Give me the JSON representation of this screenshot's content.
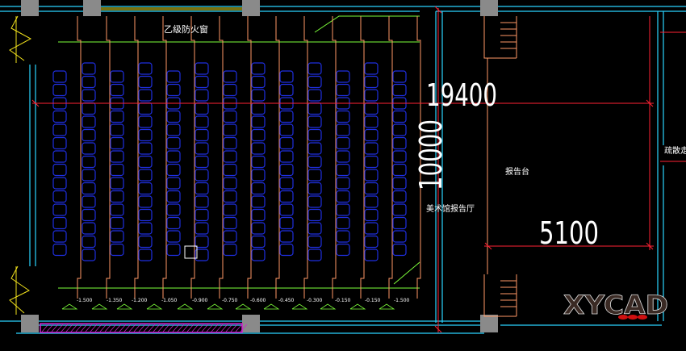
{
  "labels": {
    "window_type": "乙级防火窗",
    "stage": "报告台",
    "hall": "美术馆报告厅",
    "evac": "疏散走",
    "logo": "XYCAD"
  },
  "dimensions": {
    "total_width": "19400",
    "depth": "10000",
    "stage_width": "5100"
  },
  "elevations": [
    "-1.500",
    "-1.350",
    "-1.200",
    "-1.050",
    "-0.900",
    "-0.750",
    "-0.600",
    "-0.450",
    "-0.300",
    "-0.150",
    "-0.150"
  ],
  "colors": {
    "seat": "#1f2fe0",
    "row_line": "#ff9966",
    "dim_line": "#ff2233",
    "wall_gray": "#8a8a8a",
    "green": "#7dff3a",
    "cyan": "#2ad4ff",
    "hatch": "#d020d0",
    "yellow": "#f2e21c"
  }
}
